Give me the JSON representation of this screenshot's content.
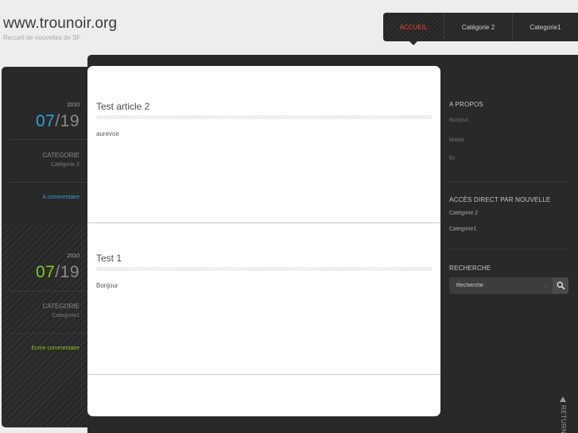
{
  "header": {
    "title": "www.trounoir.org",
    "tagline": "Recueil de nouvelles de SF"
  },
  "nav": {
    "items": [
      {
        "label": "ACCUEIL"
      },
      {
        "label": "Catégorie 2"
      },
      {
        "label": "Categorie1"
      }
    ],
    "active_color": "#ff3b3b"
  },
  "posts": [
    {
      "year": "2010",
      "month": "07",
      "slash": "/",
      "day": "19",
      "date_color": "#2aa3d6",
      "category_title": "CATEGORIE",
      "category": "Catégorie 2",
      "comment": "A commentaire",
      "comment_color": "#2aa3d6",
      "title": "Test article 2",
      "body": "aurevoir"
    },
    {
      "year": "2010",
      "month": "07",
      "slash": "/",
      "day": "19",
      "date_color": "#7dcc1f",
      "category_title": "CATEGORIE",
      "category": "Categorie1",
      "comment": "Ecrire commentaire",
      "comment_color": "#7dcc1f",
      "title": "Test 1",
      "body": "Bonjour"
    }
  ],
  "sidebar": {
    "about": {
      "title": "A PROPOS",
      "lines": [
        "Bonjour,",
        "blabla",
        "fin"
      ]
    },
    "direct": {
      "title": "ACCÈS DIRECT PAR NOUVELLE",
      "links": [
        "Catégorie 2",
        "Categorie1"
      ]
    },
    "search": {
      "title": "RECHERCHE",
      "placeholder": "Recherche"
    }
  },
  "return_label": "RETURN"
}
